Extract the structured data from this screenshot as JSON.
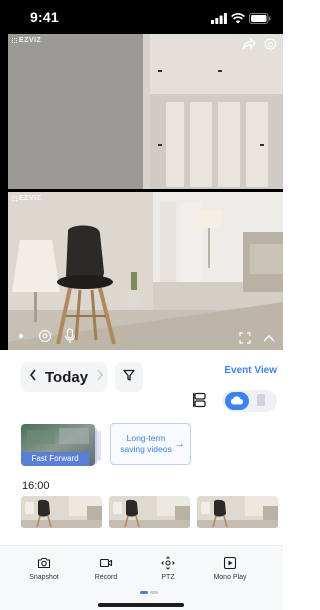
{
  "status_bar": {
    "time": "9:41"
  },
  "video": {
    "brand": "EZVIZ",
    "top_controls": [
      "share-icon",
      "settings-icon"
    ],
    "bottom_controls": [
      "record-dot-icon",
      "capture-icon",
      "microphone-icon",
      "fullscreen-icon",
      "collapse-icon"
    ]
  },
  "playback": {
    "date_label": "Today",
    "event_view_label": "Event View",
    "storage_options": [
      "cloud-icon",
      "sd-card-icon"
    ],
    "selected_storage": "cloud"
  },
  "promos": {
    "fast_forward_label": "Fast Forward",
    "long_term_label": "Long-term saving videos",
    "long_term_arrow": "→"
  },
  "timeline": {
    "time_label": "16:00"
  },
  "tabs": [
    {
      "label": "Snapshot",
      "icon": "camera-icon"
    },
    {
      "label": "Record",
      "icon": "video-record-icon"
    },
    {
      "label": "PTZ",
      "icon": "ptz-icon"
    },
    {
      "label": "Mono Play",
      "icon": "mono-play-icon"
    }
  ],
  "colors": {
    "accent": "#3b82f6",
    "status_bar": "#000000"
  }
}
